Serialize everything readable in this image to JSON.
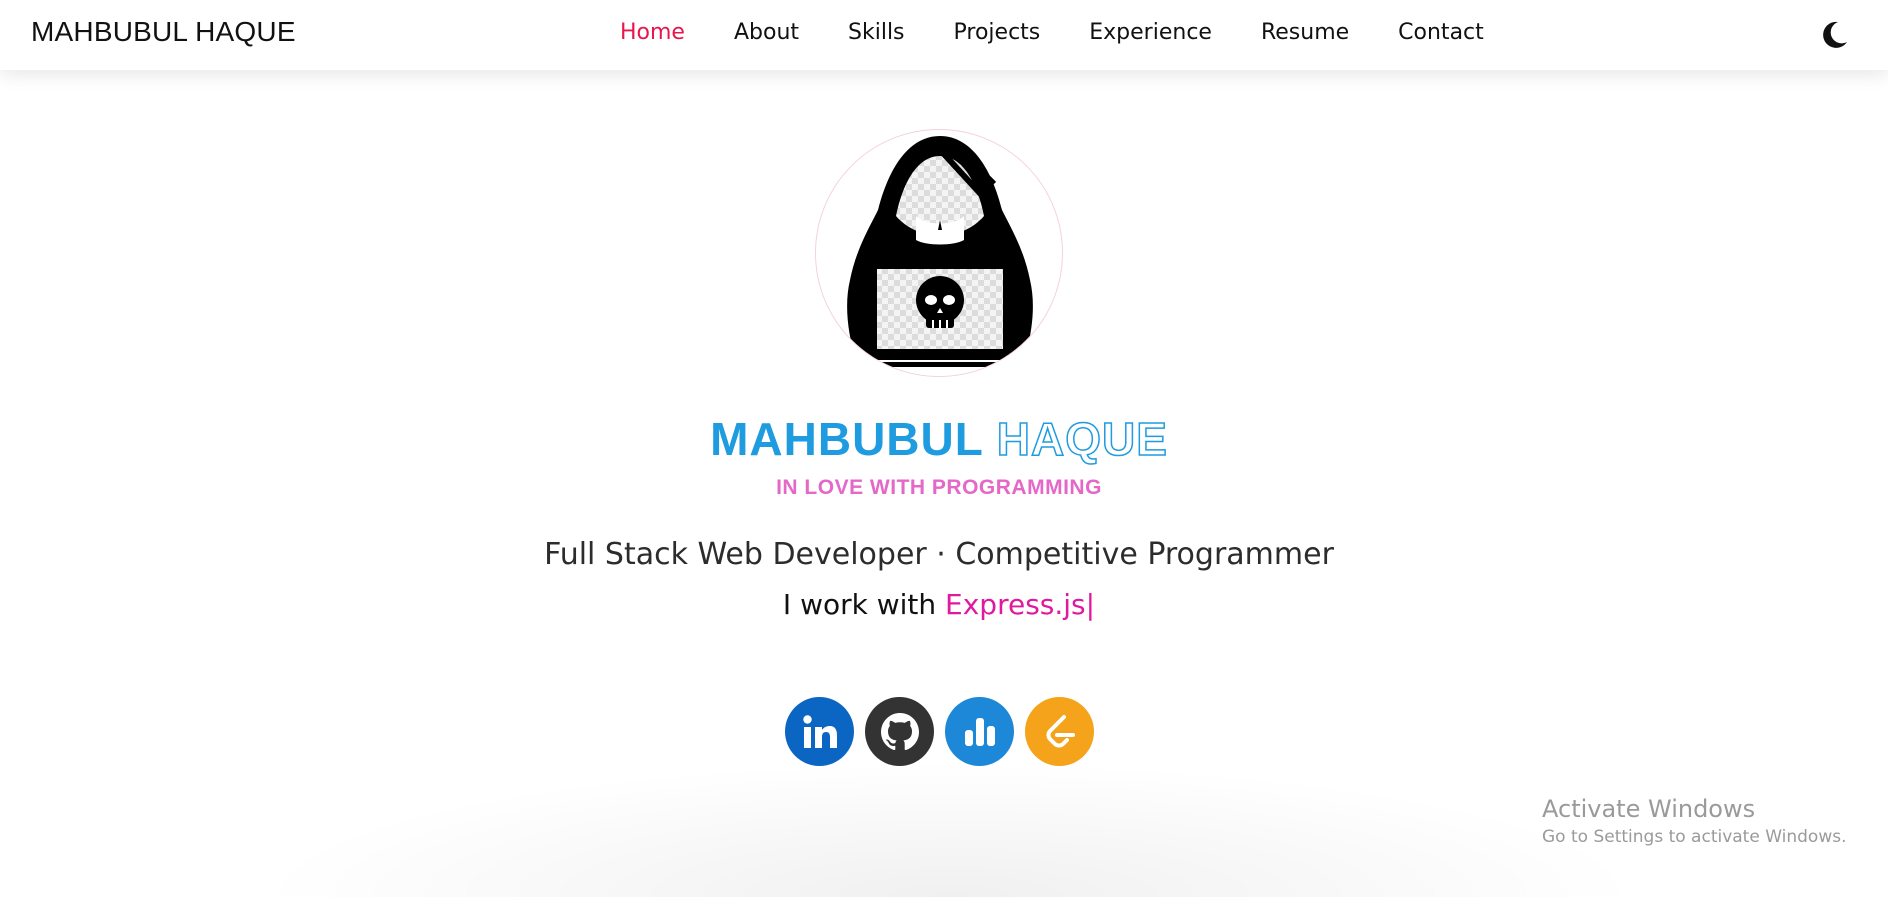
{
  "navbar": {
    "brand": "MAHBUBUL HAQUE",
    "links": [
      {
        "label": "Home",
        "active": true
      },
      {
        "label": "About"
      },
      {
        "label": "Skills"
      },
      {
        "label": "Projects"
      },
      {
        "label": "Experience"
      },
      {
        "label": "Resume"
      },
      {
        "label": "Contact"
      }
    ],
    "theme_icon": "moon-icon"
  },
  "hero": {
    "avatar_icon": "hooded-hacker-avatar",
    "name_first": "MAHBUBUL",
    "name_last": "HAQUE",
    "tagline": "IN LOVE WITH PROGRAMMING",
    "role": "Full Stack Web Developer · Competitive Programmer",
    "typing_prefix": "I work with ",
    "typing_tech": "Express.js",
    "typing_caret": "|"
  },
  "socials": [
    {
      "name": "linkedin-icon",
      "color": "#0a66c2"
    },
    {
      "name": "github-icon",
      "color": "#333333"
    },
    {
      "name": "stats-icon",
      "color": "#1e88d8"
    },
    {
      "name": "leetcode-icon",
      "color": "#f5a31a"
    }
  ],
  "colors": {
    "accent_active": "#e8164d",
    "name_blue": "#1f9be0",
    "tagline_pink": "#e567c8",
    "tech_magenta": "#e01a9e"
  },
  "watermark": {
    "title": "Activate Windows",
    "subtitle": "Go to Settings to activate Windows."
  }
}
